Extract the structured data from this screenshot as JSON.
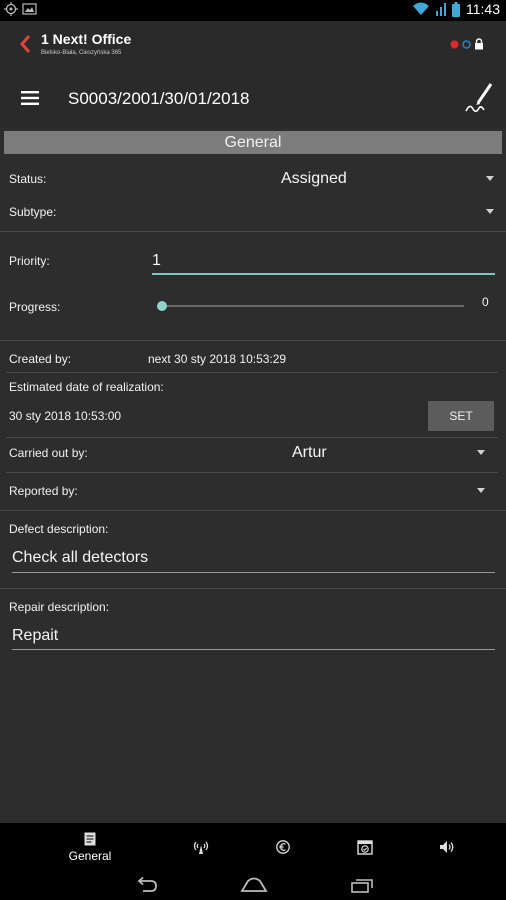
{
  "status_bar": {
    "time": "11:43"
  },
  "app_bar": {
    "title": "1 Next! Office",
    "subtitle": "Bielsko-Biała, Cieszyńska 365"
  },
  "doc_bar": {
    "title": "S0003/2001/30/01/2018"
  },
  "section": {
    "header": "General"
  },
  "form": {
    "status_label": "Status:",
    "status_value": "Assigned",
    "subtype_label": "Subtype:",
    "subtype_value": "",
    "priority_label": "Priority:",
    "priority_value": "1",
    "progress_label": "Progress:",
    "progress_value": "0",
    "created_by_label": "Created by:",
    "created_by_value": "next 30 sty 2018 10:53:29",
    "estimated_label": "Estimated date of realization:",
    "estimated_value": "30 sty 2018 10:53:00",
    "set_button": "SET",
    "carried_out_label": "Carried out by:",
    "carried_out_value": "Artur",
    "reported_by_label": "Reported by:",
    "reported_by_value": "",
    "defect_label": "Defect description:",
    "defect_value": "Check all detectors",
    "repair_label": "Repair description:",
    "repair_value": "Repait"
  },
  "bottom_nav": {
    "items": [
      {
        "label": "General",
        "icon": "document-icon"
      },
      {
        "label": "",
        "icon": "antenna-icon"
      },
      {
        "label": "",
        "icon": "euro-icon"
      },
      {
        "label": "",
        "icon": "calendar-check-icon"
      },
      {
        "label": "",
        "icon": "speaker-icon"
      }
    ]
  },
  "colors": {
    "accent": "#7fc7c3",
    "back_arrow": "#e0443a",
    "background": "#2d2d2d",
    "section_header": "#7c7c7c"
  }
}
